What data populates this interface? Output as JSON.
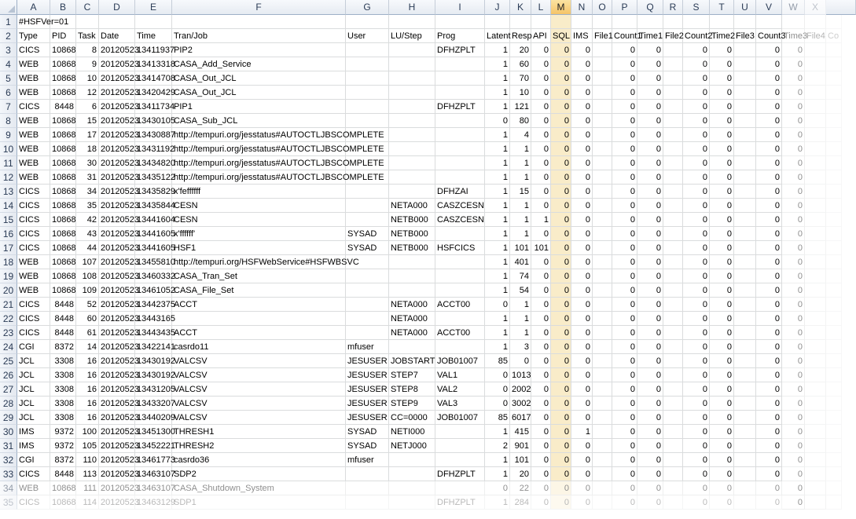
{
  "selected_column": "M",
  "column_letters": [
    "A",
    "B",
    "C",
    "D",
    "E",
    "F",
    "G",
    "H",
    "I",
    "J",
    "K",
    "L",
    "M",
    "N",
    "O",
    "P",
    "Q",
    "R",
    "S",
    "T",
    "U",
    "V",
    "W",
    "X"
  ],
  "row_numbers": [
    "1",
    "2",
    "3",
    "4",
    "5",
    "6",
    "7",
    "8",
    "9",
    "10",
    "11",
    "12",
    "13",
    "14",
    "15",
    "16",
    "17",
    "18",
    "19",
    "20",
    "21",
    "22",
    "23",
    "24",
    "25",
    "26",
    "27",
    "28",
    "29",
    "30",
    "31",
    "32",
    "33",
    "34",
    "35"
  ],
  "grid": {
    "title_row": "#HSFVer=01",
    "headers": [
      "Type",
      "PID",
      "Task",
      "Date",
      "Time",
      "Tran/Job",
      "User",
      "LU/Step",
      "Prog",
      "Latent",
      "Resp",
      "API",
      "SQL",
      "IMS",
      "File1",
      "Count1",
      "Time1",
      "File2",
      "Count2",
      "Time2",
      "File3",
      "Count3",
      "Time3",
      "File4",
      "Co"
    ],
    "rows": [
      [
        "CICS",
        "10868",
        "8",
        "20120523",
        "13411937",
        "PIP2",
        "",
        "",
        "DFHZPLT",
        "1",
        "20",
        "0",
        "0",
        "0",
        "",
        "0",
        "0",
        "",
        "0",
        "0",
        "",
        "0",
        "0"
      ],
      [
        "WEB",
        "10868",
        "9",
        "20120523",
        "13413318",
        "CASA_Add_Service",
        "",
        "",
        "",
        "1",
        "60",
        "0",
        "0",
        "0",
        "",
        "0",
        "0",
        "",
        "0",
        "0",
        "",
        "0",
        "0"
      ],
      [
        "WEB",
        "10868",
        "10",
        "20120523",
        "13414708",
        "CASA_Out_JCL",
        "",
        "",
        "",
        "1",
        "70",
        "0",
        "0",
        "0",
        "",
        "0",
        "0",
        "",
        "0",
        "0",
        "",
        "0",
        "0"
      ],
      [
        "WEB",
        "10868",
        "12",
        "20120523",
        "13420429",
        "CASA_Out_JCL",
        "",
        "",
        "",
        "1",
        "10",
        "0",
        "0",
        "0",
        "",
        "0",
        "0",
        "",
        "0",
        "0",
        "",
        "0",
        "0"
      ],
      [
        "CICS",
        "8448",
        "6",
        "20120523",
        "13411734",
        "PIP1",
        "",
        "",
        "DFHZPLT",
        "1",
        "121",
        "0",
        "0",
        "0",
        "",
        "0",
        "0",
        "",
        "0",
        "0",
        "",
        "0",
        "0"
      ],
      [
        "WEB",
        "10868",
        "15",
        "20120523",
        "13430105",
        "CASA_Sub_JCL",
        "",
        "",
        "",
        "0",
        "80",
        "0",
        "0",
        "0",
        "",
        "0",
        "0",
        "",
        "0",
        "0",
        "",
        "0",
        "0"
      ],
      [
        "WEB",
        "10868",
        "17",
        "20120523",
        "13430887",
        "http://tempuri.org/jesstatus#AUTOCTLJBSCOMPLETE",
        "",
        "",
        "",
        "1",
        "4",
        "0",
        "0",
        "0",
        "",
        "0",
        "0",
        "",
        "0",
        "0",
        "",
        "0",
        "0"
      ],
      [
        "WEB",
        "10868",
        "18",
        "20120523",
        "13431192",
        "http://tempuri.org/jesstatus#AUTOCTLJBSCOMPLETE",
        "",
        "",
        "",
        "1",
        "1",
        "0",
        "0",
        "0",
        "",
        "0",
        "0",
        "",
        "0",
        "0",
        "",
        "0",
        "0"
      ],
      [
        "WEB",
        "10868",
        "30",
        "20120523",
        "13434820",
        "http://tempuri.org/jesstatus#AUTOCTLJBSCOMPLETE",
        "",
        "",
        "",
        "1",
        "1",
        "0",
        "0",
        "0",
        "",
        "0",
        "0",
        "",
        "0",
        "0",
        "",
        "0",
        "0"
      ],
      [
        "WEB",
        "10868",
        "31",
        "20120523",
        "13435122",
        "http://tempuri.org/jesstatus#AUTOCTLJBSCOMPLETE",
        "",
        "",
        "",
        "1",
        "1",
        "0",
        "0",
        "0",
        "",
        "0",
        "0",
        "",
        "0",
        "0",
        "",
        "0",
        "0"
      ],
      [
        "CICS",
        "10868",
        "34",
        "20120523",
        "13435829",
        "x'feffffff",
        "",
        "",
        "DFHZAI",
        "1",
        "15",
        "0",
        "0",
        "0",
        "",
        "0",
        "0",
        "",
        "0",
        "0",
        "",
        "0",
        "0"
      ],
      [
        "CICS",
        "10868",
        "35",
        "20120523",
        "13435844",
        "CESN",
        "",
        "NETA000",
        "CASZCESN",
        "1",
        "1",
        "0",
        "0",
        "0",
        "",
        "0",
        "0",
        "",
        "0",
        "0",
        "",
        "0",
        "0"
      ],
      [
        "CICS",
        "10868",
        "42",
        "20120523",
        "13441604",
        "CESN",
        "",
        "NETB000",
        "CASZCESN",
        "1",
        "1",
        "1",
        "0",
        "0",
        "",
        "0",
        "0",
        "",
        "0",
        "0",
        "",
        "0",
        "0"
      ],
      [
        "CICS",
        "10868",
        "43",
        "20120523",
        "13441605",
        "x'ffffff'",
        "SYSAD",
        "NETB000",
        "",
        "1",
        "1",
        "0",
        "0",
        "0",
        "",
        "0",
        "0",
        "",
        "0",
        "0",
        "",
        "0",
        "0"
      ],
      [
        "CICS",
        "10868",
        "44",
        "20120523",
        "13441605",
        "HSF1",
        "SYSAD",
        "NETB000",
        "HSFCICS",
        "1",
        "101",
        "101",
        "0",
        "0",
        "",
        "0",
        "0",
        "",
        "0",
        "0",
        "",
        "0",
        "0"
      ],
      [
        "WEB",
        "10868",
        "107",
        "20120523",
        "13455810",
        "http://tempuri.org/HSFWebService#HSFWBSVC",
        "",
        "",
        "",
        "1",
        "401",
        "0",
        "0",
        "0",
        "",
        "0",
        "0",
        "",
        "0",
        "0",
        "",
        "0",
        "0"
      ],
      [
        "WEB",
        "10868",
        "108",
        "20120523",
        "13460332",
        "CASA_Tran_Set",
        "",
        "",
        "",
        "1",
        "74",
        "0",
        "0",
        "0",
        "",
        "0",
        "0",
        "",
        "0",
        "0",
        "",
        "0",
        "0"
      ],
      [
        "WEB",
        "10868",
        "109",
        "20120523",
        "13461052",
        "CASA_File_Set",
        "",
        "",
        "",
        "1",
        "54",
        "0",
        "0",
        "0",
        "",
        "0",
        "0",
        "",
        "0",
        "0",
        "",
        "0",
        "0"
      ],
      [
        "CICS",
        "8448",
        "52",
        "20120523",
        "13442375",
        "ACCT",
        "",
        "NETA000",
        "ACCT00",
        "0",
        "1",
        "0",
        "0",
        "0",
        "",
        "0",
        "0",
        "",
        "0",
        "0",
        "",
        "0",
        "0"
      ],
      [
        "CICS",
        "8448",
        "60",
        "20120523",
        "13443165",
        "",
        "",
        "NETA000",
        "",
        "1",
        "1",
        "0",
        "0",
        "0",
        "",
        "0",
        "0",
        "",
        "0",
        "0",
        "",
        "0",
        "0"
      ],
      [
        "CICS",
        "8448",
        "61",
        "20120523",
        "13443435",
        "ACCT",
        "",
        "NETA000",
        "ACCT00",
        "1",
        "1",
        "0",
        "0",
        "0",
        "",
        "0",
        "0",
        "",
        "0",
        "0",
        "",
        "0",
        "0"
      ],
      [
        "CGI",
        "8372",
        "14",
        "20120523",
        "13422141",
        "casrdo11",
        "mfuser",
        "",
        "",
        "1",
        "3",
        "0",
        "0",
        "0",
        "",
        "0",
        "0",
        "",
        "0",
        "0",
        "",
        "0",
        "0"
      ],
      [
        "JCL",
        "3308",
        "16",
        "20120523",
        "13430192",
        "VALCSV",
        "JESUSER",
        "JOBSTART",
        "JOB01007",
        "85",
        "0",
        "0",
        "0",
        "0",
        "",
        "0",
        "0",
        "",
        "0",
        "0",
        "",
        "0",
        "0"
      ],
      [
        "JCL",
        "3308",
        "16",
        "20120523",
        "13430192",
        "VALCSV",
        "JESUSER",
        "STEP7",
        "VAL1",
        "0",
        "1013",
        "0",
        "0",
        "0",
        "",
        "0",
        "0",
        "",
        "0",
        "0",
        "",
        "0",
        "0"
      ],
      [
        "JCL",
        "3308",
        "16",
        "20120523",
        "13431205",
        "VALCSV",
        "JESUSER",
        "STEP8",
        "VAL2",
        "0",
        "2002",
        "0",
        "0",
        "0",
        "",
        "0",
        "0",
        "",
        "0",
        "0",
        "",
        "0",
        "0"
      ],
      [
        "JCL",
        "3308",
        "16",
        "20120523",
        "13433207",
        "VALCSV",
        "JESUSER",
        "STEP9",
        "VAL3",
        "0",
        "3002",
        "0",
        "0",
        "0",
        "",
        "0",
        "0",
        "",
        "0",
        "0",
        "",
        "0",
        "0"
      ],
      [
        "JCL",
        "3308",
        "16",
        "20120523",
        "13440209",
        "VALCSV",
        "JESUSER",
        "CC=0000",
        "JOB01007",
        "85",
        "6017",
        "0",
        "0",
        "0",
        "",
        "0",
        "0",
        "",
        "0",
        "0",
        "",
        "0",
        "0"
      ],
      [
        "IMS",
        "9372",
        "100",
        "20120523",
        "13451300",
        "THRESH1",
        "SYSAD",
        "NETI000",
        "",
        "1",
        "415",
        "0",
        "0",
        "1",
        "",
        "0",
        "0",
        "",
        "0",
        "0",
        "",
        "0",
        "0"
      ],
      [
        "IMS",
        "9372",
        "105",
        "20120523",
        "13452221",
        "THRESH2",
        "SYSAD",
        "NETJ000",
        "",
        "2",
        "901",
        "0",
        "0",
        "0",
        "",
        "0",
        "0",
        "",
        "0",
        "0",
        "",
        "0",
        "0"
      ],
      [
        "CGI",
        "8372",
        "110",
        "20120523",
        "13461773",
        "casrdo36",
        "mfuser",
        "",
        "",
        "1",
        "101",
        "0",
        "0",
        "0",
        "",
        "0",
        "0",
        "",
        "0",
        "0",
        "",
        "0",
        "0"
      ],
      [
        "CICS",
        "8448",
        "113",
        "20120523",
        "13463107",
        "SDP2",
        "",
        "",
        "DFHZPLT",
        "1",
        "20",
        "0",
        "0",
        "0",
        "",
        "0",
        "0",
        "",
        "0",
        "0",
        "",
        "0",
        "0"
      ],
      [
        "WEB",
        "10868",
        "111",
        "20120523",
        "13463107",
        "CASA_Shutdown_System",
        "",
        "",
        "",
        "0",
        "22",
        "0",
        "0",
        "0",
        "",
        "0",
        "0",
        "",
        "0",
        "0",
        "",
        "0",
        "0"
      ],
      [
        "CICS",
        "10868",
        "114",
        "20120523",
        "13463129",
        "SDP1",
        "",
        "",
        "DFHZPLT",
        "1",
        "284",
        "0",
        "0",
        "0",
        "",
        "0",
        "0",
        "",
        "0",
        "0",
        "",
        "0",
        "0"
      ]
    ]
  }
}
